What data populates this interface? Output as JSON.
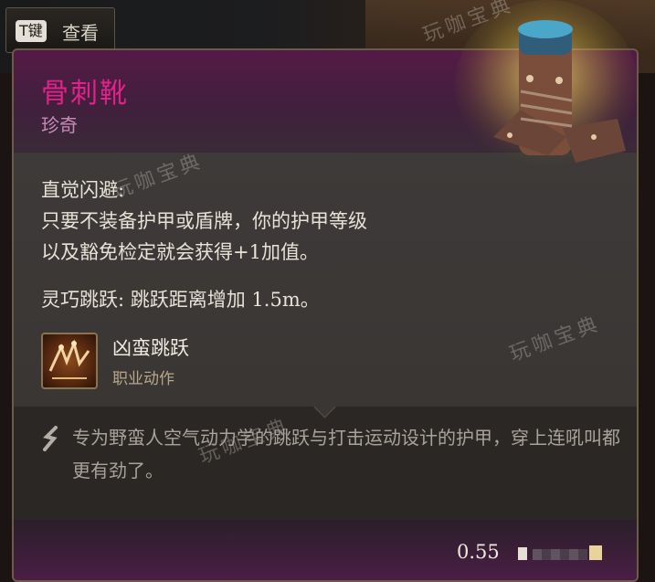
{
  "hint": {
    "key": "T键",
    "label": "查看"
  },
  "item": {
    "name": "骨刺靴",
    "rarity": "珍奇"
  },
  "properties": {
    "line1": "直觉闪避:",
    "line2": "只要不装备护甲或盾牌，你的护甲等级",
    "line3": "以及豁免检定就会获得+1加值。",
    "line4": "灵巧跳跃: 跳跃距离增加 1.5m。"
  },
  "action": {
    "name": "凶蛮跳跃",
    "type": "职业动作",
    "icon": "jump-action-icon"
  },
  "flavor": {
    "text": "专为野蛮人空气动力学的跳跃与打击运动设计的护甲，穿上连吼叫都更有劲了。",
    "icon": "quill-icon"
  },
  "footer": {
    "weight": "0.55"
  },
  "watermark": "玩咖宝典",
  "colors": {
    "name": "#e0228a",
    "rarity": "#c78bb6",
    "header": "#541a47",
    "body": "#3f3a38"
  }
}
